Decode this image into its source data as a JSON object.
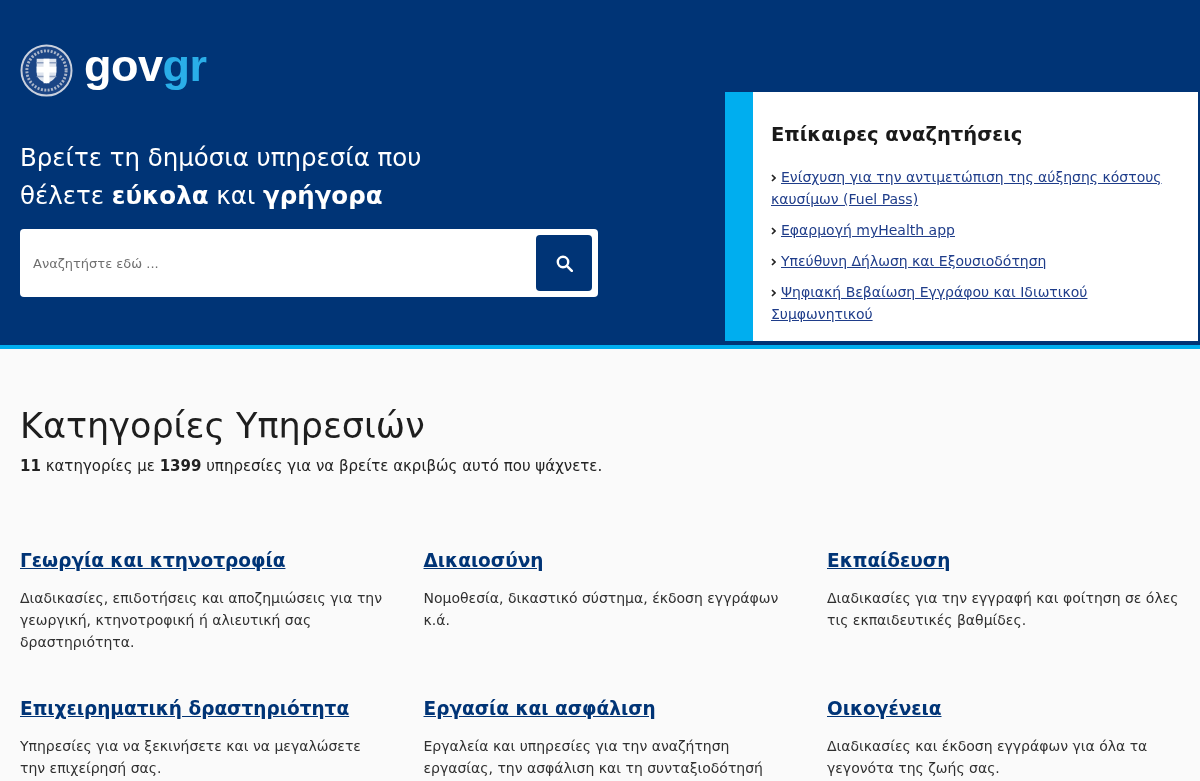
{
  "header": {
    "logo": {
      "wordmark": "gov",
      "accent": "gr"
    },
    "headline": "Βρείτε τη δημόσια υπηρεσία που θέλετε **εύκολα** και **γρήγορα**",
    "search": {
      "placeholder": "Αναζητήστε εδώ ..."
    }
  },
  "trending": {
    "title": "Επίκαιρες αναζητήσεις",
    "links": [
      "Ενίσχυση για την αντιμετώπιση της αύξησης κόστους καυσίμων (Fuel Pass)",
      "Εφαρμογή myHealth app",
      "Υπεύθυνη Δήλωση και Εξουσιοδότηση",
      "Ψηφιακή Βεβαίωση Εγγράφου και Ιδιωτικού Συμφωνητικού"
    ]
  },
  "categories": {
    "title": "Κατηγορίες Υπηρεσιών",
    "summary": "**11** κατηγορίες με **1399** υπηρεσίες για να βρείτε ακριβώς αυτό που ψάχνετε.",
    "items": [
      {
        "title": "Γεωργία και κτηνοτροφία",
        "description": "Διαδικασίες, επιδοτήσεις και αποζημιώσεις για την γεωργική, κτηνοτροφική ή αλιευτική σας δραστηριότητα."
      },
      {
        "title": "Δικαιοσύνη",
        "description": "Νομοθεσία, δικαστικό σύστημα, έκδοση εγγράφων κ.ά."
      },
      {
        "title": "Εκπαίδευση",
        "description": "Διαδικασίες για την εγγραφή και φοίτηση σε όλες τις εκπαιδευτικές βαθμίδες."
      },
      {
        "title": "Επιχειρηματική δραστηριότητα",
        "description": "Υπηρεσίες για να ξεκινήσετε και να μεγαλώσετε την επιχείρησή σας."
      },
      {
        "title": "Εργασία και ασφάλιση",
        "description": "Εργαλεία και υπηρεσίες για την αναζήτηση εργασίας, την ασφάλιση και τη συνταξιοδότησή"
      },
      {
        "title": "Οικογένεια",
        "description": "Διαδικασίες και έκδοση εγγράφων για όλα τα γεγονότα της ζωής σας."
      }
    ]
  }
}
